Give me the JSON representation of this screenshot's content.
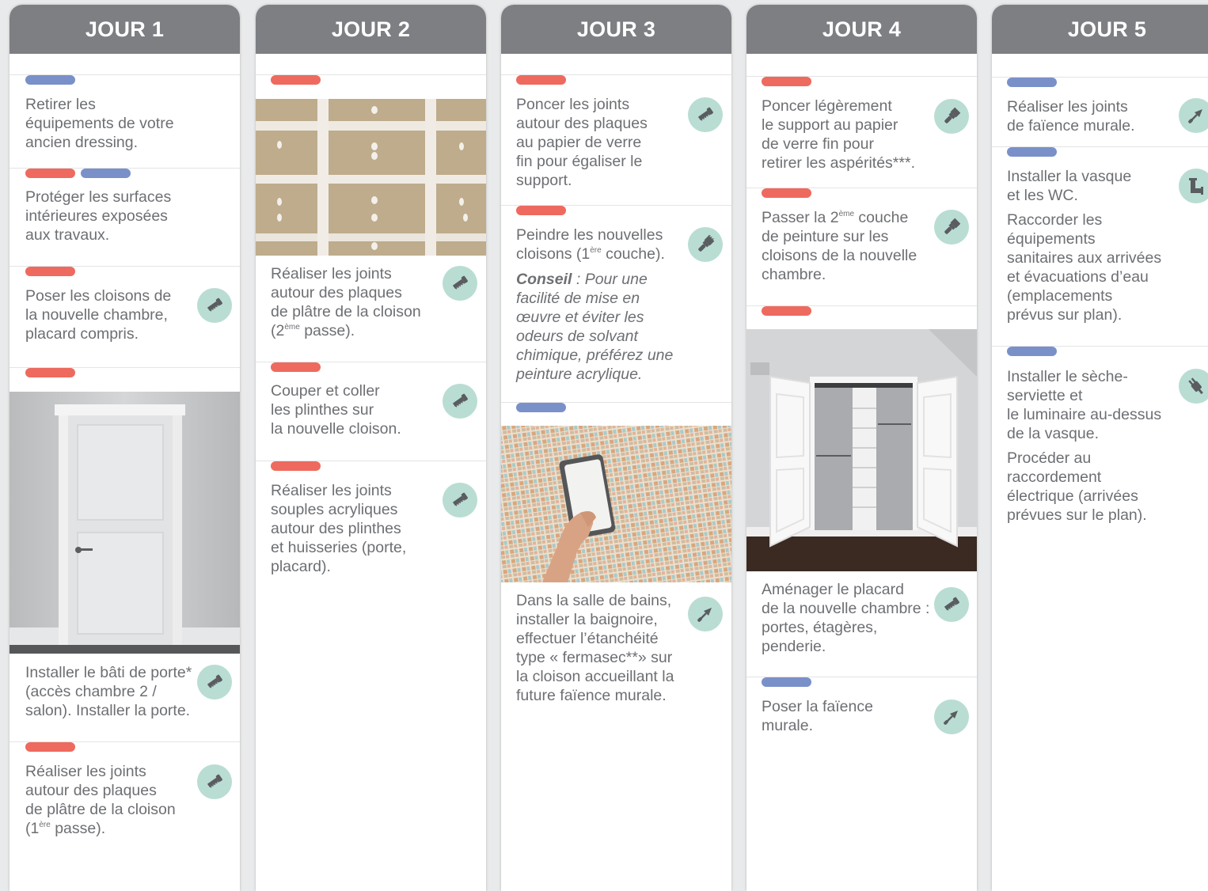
{
  "colors": {
    "header": "#7d7f83",
    "pill_red": "#ee6a5e",
    "pill_blue": "#7a90c9",
    "icon_bg": "#b9ddd3",
    "icon_fg": "#5a5c60",
    "text": "#6d6f73"
  },
  "days": [
    {
      "title": "JOUR 1",
      "tasks": [
        {
          "pills": [
            "blue"
          ],
          "lines": [
            "Retirer les",
            "équipements de votre",
            "ancien dressing."
          ],
          "icon": null
        },
        {
          "pills": [
            "red",
            "blue"
          ],
          "lines": [
            "Protéger les surfaces",
            "intérieures exposées",
            "aux travaux."
          ],
          "icon": null
        },
        {
          "pills": [
            "red"
          ],
          "lines": [
            "Poser les cloisons de",
            "la nouvelle chambre,",
            "placard compris."
          ],
          "icon": "saw-icon"
        },
        {
          "pills": [
            "red"
          ],
          "image": "white-door-photo"
        },
        {
          "lines": [
            "Installer le bâti de porte*",
            "(accès chambre 2 /",
            "salon). Installer la porte."
          ],
          "icon": "saw-icon"
        },
        {
          "pills": [
            "red"
          ],
          "lines": [
            "Réaliser les joints",
            "autour des plaques",
            "de plâtre de la cloison"
          ],
          "sup_line": {
            "pre": "(1",
            "sup": "ère",
            "post": " passe)."
          },
          "icon": "saw-icon"
        }
      ]
    },
    {
      "title": "JOUR 2",
      "tasks": [
        {
          "pills": [
            "red"
          ],
          "image": "plasterboard-joints-photo"
        },
        {
          "lines": [
            "Réaliser les joints",
            "autour des plaques",
            "de plâtre de la cloison"
          ],
          "sup_line": {
            "pre": "(2",
            "sup": "ème",
            "post": " passe)."
          },
          "icon": "saw-icon"
        },
        {
          "pills": [
            "red"
          ],
          "lines": [
            "Couper et coller",
            "les plinthes sur",
            "la nouvelle cloison."
          ],
          "icon": "saw-icon"
        },
        {
          "pills": [
            "red"
          ],
          "lines": [
            "Réaliser les joints",
            "souples acryliques",
            "autour des plinthes",
            "et huisseries (porte,",
            "placard)."
          ],
          "icon": "saw-icon"
        }
      ]
    },
    {
      "title": "JOUR 3",
      "tasks": [
        {
          "pills": [
            "red"
          ],
          "lines": [
            "Poncer les joints",
            "autour des plaques",
            "au papier de verre",
            "fin pour égaliser le",
            "support."
          ],
          "icon": "saw-icon"
        },
        {
          "pills": [
            "red"
          ],
          "lines": [
            "Peindre les nouvelles"
          ],
          "sup_line": {
            "pre": "cloisons (1",
            "sup": "ère",
            "post": " couche)."
          },
          "icon": "paintbrush-icon",
          "note": {
            "label": "Conseil",
            "lines": [
              " : Pour une",
              "facilité de mise en",
              "œuvre et éviter les",
              "odeurs de solvant",
              "chimique, préférez une",
              "peinture acrylique."
            ]
          }
        },
        {
          "pills": [
            "blue"
          ],
          "image": "tile-grouting-photo"
        },
        {
          "lines": [
            "Dans la salle de bains,",
            "installer la baignoire,",
            "effectuer l’étanchéité",
            "type « fermasec**» sur",
            "la cloison accueillant la",
            "future faïence murale."
          ],
          "icon": "trowel-icon"
        }
      ]
    },
    {
      "title": "JOUR 4",
      "tasks": [
        {
          "pills": [
            "red"
          ],
          "lines": [
            "Poncer légèrement",
            "le support au papier",
            "de verre fin pour",
            "retirer les aspérités***."
          ],
          "icon": "paintbrush-icon"
        },
        {
          "pills": [
            "red"
          ],
          "sup_line_first": {
            "pre": "Passer la 2",
            "sup": "ème",
            "post": " couche"
          },
          "lines": [
            "de peinture sur les",
            "cloisons de la nouvelle",
            "chambre."
          ],
          "icon": "paintbrush-icon"
        },
        {
          "pills": [
            "red"
          ],
          "image": "closet-photo"
        },
        {
          "lines": [
            "Aménager le placard",
            "de la nouvelle chambre :",
            "portes, étagères,",
            "penderie."
          ],
          "icon": "saw-icon"
        },
        {
          "pills": [
            "blue"
          ],
          "lines": [
            "Poser la faïence",
            "murale."
          ],
          "icon": "trowel-icon"
        }
      ]
    },
    {
      "title": "JOUR 5",
      "tasks": [
        {
          "pills": [
            "blue"
          ],
          "lines": [
            "Réaliser les joints",
            "de faïence murale."
          ],
          "icon": "trowel-icon"
        },
        {
          "pills": [
            "blue"
          ],
          "lines": [
            "Installer la vasque",
            "et les WC."
          ],
          "icon": "pipe-icon",
          "extra_lines": [
            "Raccorder les",
            "équipements",
            "sanitaires aux arrivées",
            "et évacuations d’eau",
            "(emplacements",
            "prévus sur plan)."
          ]
        },
        {
          "pills": [
            "blue"
          ],
          "lines": [
            "Installer le sèche-",
            "serviette et",
            "le luminaire au-dessus",
            "de la vasque."
          ],
          "icon": "plug-icon",
          "extra_lines": [
            "Procéder au",
            "raccordement",
            "électrique (arrivées",
            "prévues sur le plan)."
          ]
        }
      ]
    }
  ]
}
